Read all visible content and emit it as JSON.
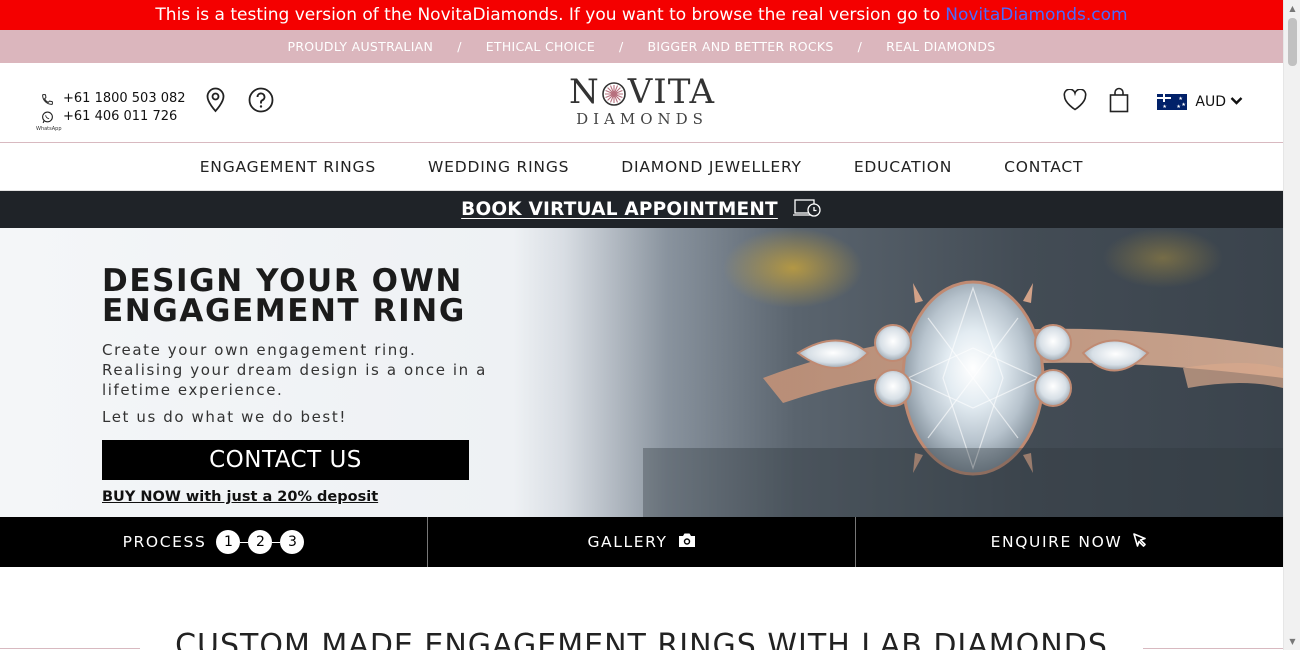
{
  "banner": {
    "text": "This is a testing version of the NovitaDiamonds. If you want to browse the real version go to",
    "link_text": "NovitaDiamonds.com",
    "colors": {
      "background": "#f40000",
      "link": "#4a6bff"
    }
  },
  "usp": {
    "items": [
      "PROUDLY AUSTRALIAN",
      "ETHICAL CHOICE",
      "BIGGER AND BETTER ROCKS",
      "REAL DIAMONDS"
    ],
    "separator": "/",
    "colors": {
      "background": "#dbb6bd"
    }
  },
  "header": {
    "phone": "+61 1800 503 082",
    "whatsapp": "+61 406 011 726",
    "whatsapp_label": "WhatsApp",
    "logo_top_left": "N",
    "logo_top_right": "VITA",
    "logo_bottom": "DIAMONDS",
    "currency": "AUD",
    "icons": [
      "phone-icon",
      "whatsapp-icon",
      "location-pin-icon",
      "help-icon",
      "heart-icon",
      "shopping-bag-icon",
      "australia-flag-icon",
      "chevron-down-icon"
    ]
  },
  "nav": {
    "items": [
      "ENGAGEMENT RINGS",
      "WEDDING RINGS",
      "DIAMOND JEWELLERY",
      "EDUCATION",
      "CONTACT"
    ]
  },
  "appointment": {
    "label": "BOOK VIRTUAL APPOINTMENT",
    "icon": "laptop-clock-icon"
  },
  "hero": {
    "title_line1": "DESIGN YOUR OWN",
    "title_line2": "ENGAGEMENT RING",
    "text": "Create your own engagement ring. Realising your dream design is a once in a lifetime experience.",
    "text2": "Let us do what we do best!",
    "cta": "CONTACT US",
    "deposit": "BUY NOW with just a 20% deposit"
  },
  "process_bar": {
    "process_label": "PROCESS",
    "steps": [
      "1",
      "2",
      "3"
    ],
    "gallery_label": "GALLERY",
    "enquire_label": "ENQUIRE NOW"
  },
  "section": {
    "title": "CUSTOM MADE ENGAGEMENT RINGS WITH LAB DIAMONDS"
  }
}
